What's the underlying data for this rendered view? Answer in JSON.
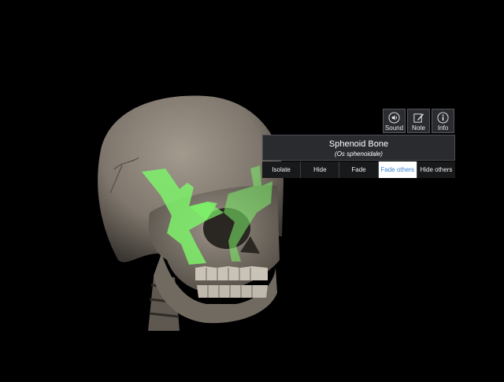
{
  "toolbar": {
    "sound_label": "Sound",
    "note_label": "Note",
    "info_label": "Info"
  },
  "selection": {
    "name": "Sphenoid Bone",
    "latin_name": "(Os sphenoidale)"
  },
  "actions": [
    {
      "label": "Isolate",
      "selected": false
    },
    {
      "label": "Hide",
      "selected": false
    },
    {
      "label": "Fade",
      "selected": false
    },
    {
      "label": "Fade others",
      "selected": true
    },
    {
      "label": "Hide others",
      "selected": false
    }
  ],
  "colors": {
    "background": "#000000",
    "highlight": "#7ef26a",
    "selected_text": "#3c86d8"
  }
}
